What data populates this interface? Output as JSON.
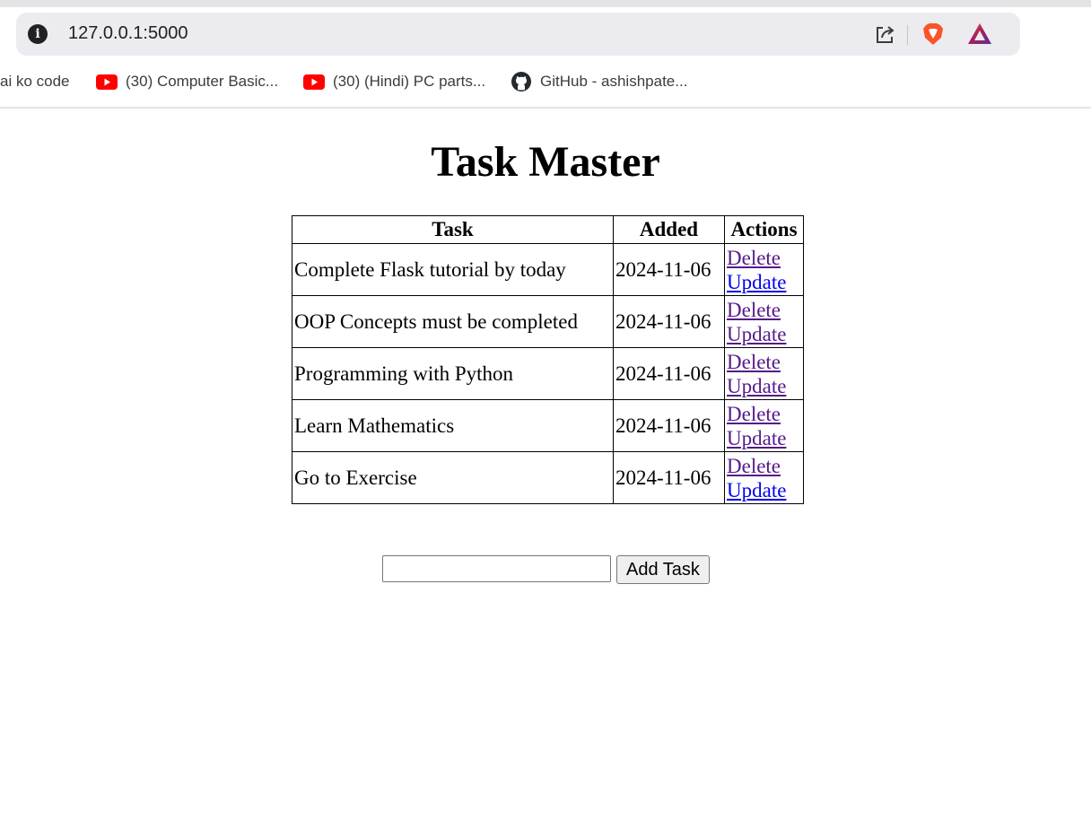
{
  "browser": {
    "url": "127.0.0.1:5000",
    "bookmarks": [
      {
        "label": "ai ko code",
        "icon": "none"
      },
      {
        "label": "(30) Computer Basic...",
        "icon": "youtube-icon"
      },
      {
        "label": "(30) (Hindi) PC parts...",
        "icon": "youtube-icon"
      },
      {
        "label": "GitHub - ashishpate...",
        "icon": "github-icon"
      }
    ]
  },
  "page": {
    "title": "Task Master",
    "table": {
      "headers": {
        "task": "Task",
        "added": "Added",
        "actions": "Actions"
      },
      "rows": [
        {
          "task": "Complete Flask tutorial by today",
          "added": "2024-11-06",
          "delete": "Delete",
          "update": "Update"
        },
        {
          "task": "OOP Concepts must be completed",
          "added": "2024-11-06",
          "delete": "Delete",
          "update": "Update"
        },
        {
          "task": "Programming with Python",
          "added": "2024-11-06",
          "delete": "Delete",
          "update": "Update"
        },
        {
          "task": "Learn Mathematics",
          "added": "2024-11-06",
          "delete": "Delete",
          "update": "Update"
        },
        {
          "task": "Go to Exercise",
          "added": "2024-11-06",
          "delete": "Delete",
          "update": "Update"
        }
      ]
    },
    "form": {
      "input_value": "",
      "button_label": "Add Task"
    }
  },
  "colors": {
    "link": "#0000ee",
    "visited_link": "#551a8b",
    "youtube": "#ff0000",
    "brave": "#fb542b"
  }
}
